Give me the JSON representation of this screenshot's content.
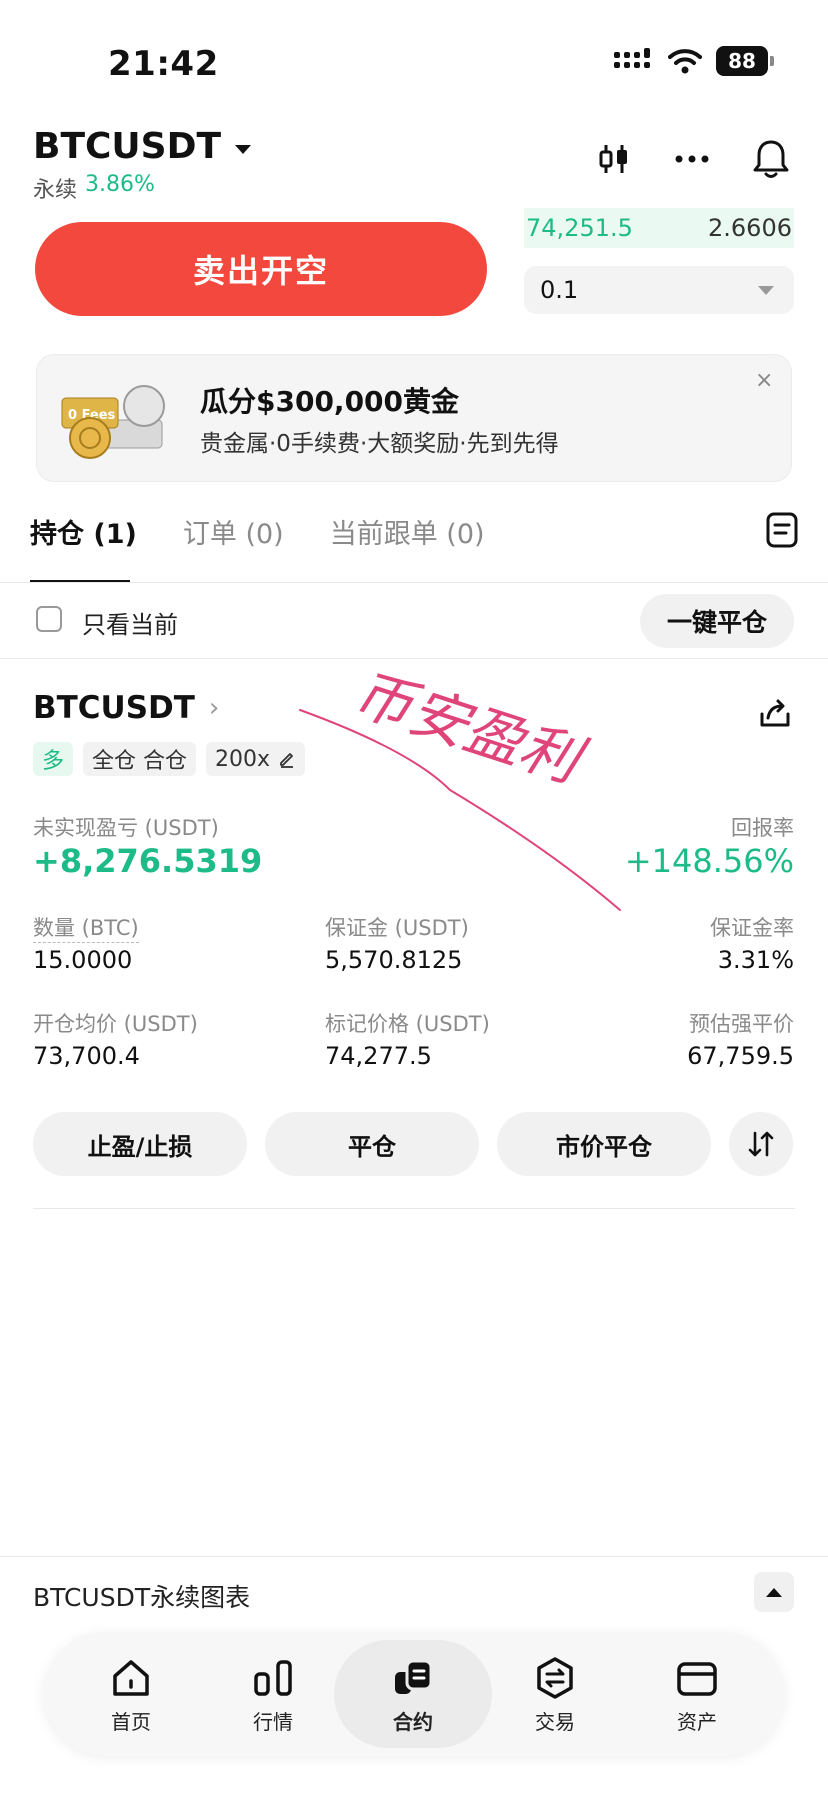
{
  "status_bar": {
    "time": "21:42",
    "battery": "88"
  },
  "header": {
    "pair": "BTCUSDT",
    "perp_label": "永续",
    "change": "3.86%"
  },
  "trade": {
    "sell_open_short_label": "卖出开空",
    "orderbook_price": "74,251.5",
    "orderbook_qty": "2.6606",
    "qty_value": "0.1"
  },
  "banner": {
    "title": "瓜分$300,000黄金",
    "subtitle": "贵金属·0手续费·大额奖励·先到先得",
    "close": "×",
    "image_text": "0 Fees"
  },
  "tabs": [
    {
      "label": "持仓 (1)"
    },
    {
      "label": "订单 (0)"
    },
    {
      "label": "当前跟单 (0)"
    }
  ],
  "filter": {
    "only_current_label": "只看当前",
    "close_all_label": "一键平仓"
  },
  "position": {
    "symbol": "BTCUSDT",
    "side_tag": "多",
    "margin_tag": "全仓 合仓",
    "leverage_tag": "200x",
    "unrealized_pnl_label": "未实现盈亏 (USDT)",
    "unrealized_pnl_value": "+8,276.5319",
    "roe_label": "回报率",
    "roe_value": "+148.56%",
    "qty_label": "数量 (BTC)",
    "qty_value": "15.0000",
    "margin_label": "保证金 (USDT)",
    "margin_value": "5,570.8125",
    "margin_ratio_label": "保证金率",
    "margin_ratio_value": "3.31%",
    "entry_label": "开仓均价 (USDT)",
    "entry_value": "73,700.4",
    "mark_label": "标记价格 (USDT)",
    "mark_value": "74,277.5",
    "liq_label": "预估强平价",
    "liq_value": "67,759.5",
    "handwriting": "币安盈利"
  },
  "actions": {
    "tpsl": "止盈/止损",
    "close": "平仓",
    "market_close": "市价平仓"
  },
  "chart_bar": {
    "label": "BTCUSDT永续图表"
  },
  "nav": [
    {
      "label": "首页"
    },
    {
      "label": "行情"
    },
    {
      "label": "合约"
    },
    {
      "label": "交易"
    },
    {
      "label": "资产"
    }
  ],
  "colors": {
    "green": "#1dbb87",
    "red": "#f2483e",
    "handwriting": "#e0457a"
  }
}
